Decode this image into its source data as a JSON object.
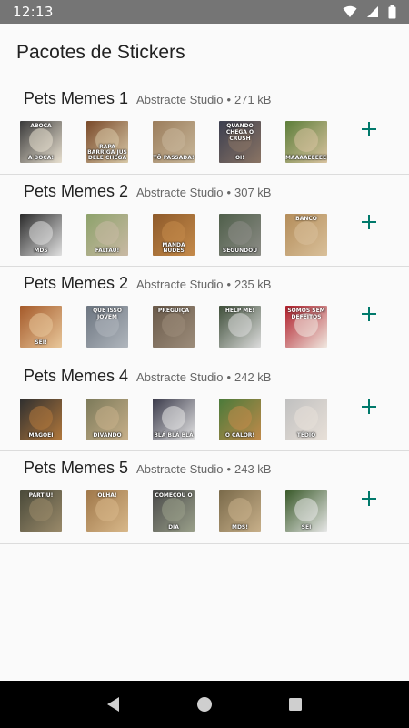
{
  "status_bar": {
    "time": "12:13"
  },
  "app": {
    "title": "Pacotes de Stickers"
  },
  "packs": [
    {
      "name": "Pets Memes 1",
      "publisher": "Abstracte Studio",
      "size": "271 kB",
      "stickers": [
        {
          "caption": "A BOCA!",
          "top": "ABOCA",
          "colors": [
            "#3b3b3b",
            "#e8e0d0"
          ]
        },
        {
          "caption": "RAPA BARRIGA JUS DELE CHEGA",
          "top": "",
          "colors": [
            "#7a4a2a",
            "#d8c9a8"
          ]
        },
        {
          "caption": "TÔ PASSADA!",
          "top": "",
          "colors": [
            "#9b7d5c",
            "#c8b79a"
          ]
        },
        {
          "caption": "OI!",
          "top": "QUANDO CHEGA O CRUSH",
          "colors": [
            "#3c3f50",
            "#8a7464"
          ]
        },
        {
          "caption": "MAAAAEEEEE!",
          "top": "",
          "colors": [
            "#5d7e3a",
            "#d9c3a0"
          ]
        }
      ]
    },
    {
      "name": "Pets Memes 2",
      "publisher": "Abstracte Studio",
      "size": "307 kB",
      "stickers": [
        {
          "caption": "MDS",
          "top": "",
          "colors": [
            "#2a2a2a",
            "#e0e0e0"
          ]
        },
        {
          "caption": "FALTAU!",
          "top": "",
          "colors": [
            "#8da26b",
            "#c9b9a4"
          ]
        },
        {
          "caption": "MANDA NUDES",
          "top": "",
          "colors": [
            "#8e5a2a",
            "#c48a4a"
          ]
        },
        {
          "caption": "SEGUNDOU",
          "top": "",
          "colors": [
            "#4f5f4a",
            "#8c8c86"
          ]
        },
        {
          "caption": "",
          "top": "BANCO",
          "colors": [
            "#b48d5a",
            "#d9c09a"
          ]
        }
      ]
    },
    {
      "name": "Pets Memes 2",
      "publisher": "Abstracte Studio",
      "size": "235 kB",
      "stickers": [
        {
          "caption": "SEI!",
          "top": "",
          "colors": [
            "#a55a2a",
            "#e8c79a"
          ]
        },
        {
          "caption": "",
          "top": "QUE ISSO JOVEM",
          "colors": [
            "#6c7580",
            "#b0b6bd"
          ]
        },
        {
          "caption": "",
          "top": "PREGUIÇA",
          "colors": [
            "#6a5a4a",
            "#9c8c7a"
          ]
        },
        {
          "caption": "",
          "top": "HELP ME!",
          "colors": [
            "#3f4f3a",
            "#dcdcdc"
          ]
        },
        {
          "caption": "",
          "top": "SOMOS SEM DEFEITOS",
          "colors": [
            "#b01e2a",
            "#f0e8e0"
          ]
        }
      ]
    },
    {
      "name": "Pets Memes 4",
      "publisher": "Abstracte Studio",
      "size": "242 kB",
      "stickers": [
        {
          "caption": "MAGOEI",
          "top": "",
          "colors": [
            "#2f2f2f",
            "#b2783c"
          ]
        },
        {
          "caption": "DIVANDO",
          "top": "",
          "colors": [
            "#7c7a5a",
            "#c8b08a"
          ]
        },
        {
          "caption": "BLÁ BLÁ BLÁ",
          "top": "",
          "colors": [
            "#3a3a4a",
            "#e6e6e6"
          ]
        },
        {
          "caption": "O CALOR!",
          "top": "",
          "colors": [
            "#4a7a3a",
            "#c28a4a"
          ]
        },
        {
          "caption": "TÉDIO",
          "top": "",
          "colors": [
            "#c0c0c0",
            "#e8e0d8"
          ]
        }
      ]
    },
    {
      "name": "Pets Memes 5",
      "publisher": "Abstracte Studio",
      "size": "243 kB",
      "stickers": [
        {
          "caption": "",
          "top": "PARTIU!",
          "colors": [
            "#4a4a3a",
            "#9a8a6a"
          ]
        },
        {
          "caption": "",
          "top": "OLHA!",
          "colors": [
            "#a0784a",
            "#d8b88a"
          ]
        },
        {
          "caption": "DIA",
          "top": "COMEÇOU O",
          "colors": [
            "#4a4a4a",
            "#9aa08a"
          ]
        },
        {
          "caption": "MDS!",
          "top": "",
          "colors": [
            "#7a6a4a",
            "#c8b08a"
          ]
        },
        {
          "caption": "SEI",
          "top": "",
          "colors": [
            "#3a5a2a",
            "#e8e8e8"
          ]
        }
      ]
    }
  ],
  "colors": {
    "accent": "#00796b",
    "status_bar": "#757575",
    "nav_bar": "#000000"
  },
  "icons": {
    "add": "plus-icon",
    "back": "back-triangle-icon",
    "home": "home-circle-icon",
    "recents": "recents-square-icon"
  }
}
